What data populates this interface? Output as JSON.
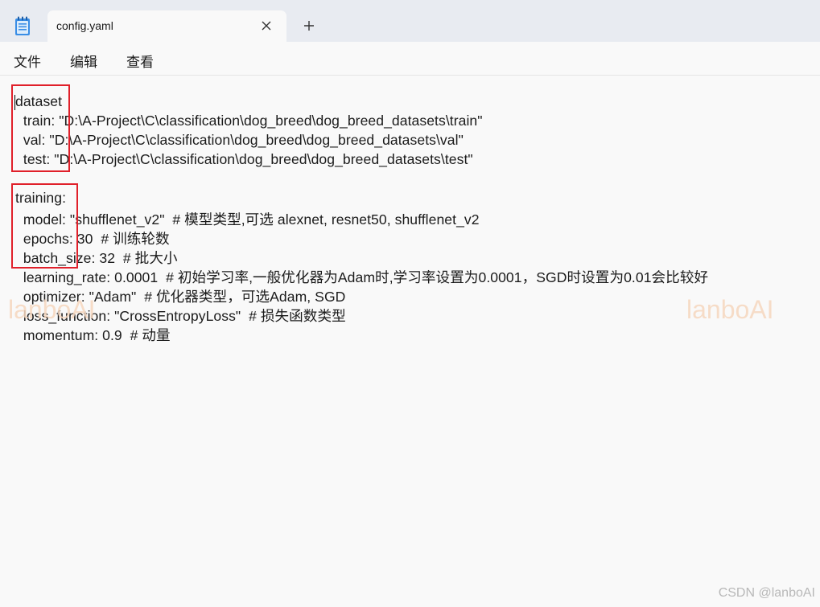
{
  "tab": {
    "title": "config.yaml"
  },
  "menu": {
    "file": "文件",
    "edit": "编辑",
    "view": "查看"
  },
  "code_lines": [
    "dataset",
    "  train: \"D:\\A-Project\\C\\classification\\dog_breed\\dog_breed_datasets\\train\"",
    "  val: \"D:\\A-Project\\C\\classification\\dog_breed\\dog_breed_datasets\\val\"",
    "  test: \"D:\\A-Project\\C\\classification\\dog_breed\\dog_breed_datasets\\test\"",
    "",
    "training:",
    "  model: \"shufflenet_v2\"  # 模型类型,可选 alexnet, resnet50, shufflenet_v2",
    "  epochs: 30  # 训练轮数",
    "  batch_size: 32  # 批大小",
    "  learning_rate: 0.0001  # 初始学习率,一般优化器为Adam时,学习率设置为0.0001，SGD时设置为0.01会比较好",
    "  optimizer: \"Adam\"  # 优化器类型，可选Adam, SGD",
    "  loss_function: \"CrossEntropyLoss\"  # 损失函数类型",
    "  momentum: 0.9  # 动量"
  ],
  "watermark": "lanboAI",
  "credit": "CSDN @lanboAI",
  "colors": {
    "highlight": "#e0202a",
    "tabbar": "#e8ebf1",
    "editor_bg": "#f9f9f9"
  },
  "icons": {
    "app": "notepad-icon",
    "close": "close-icon",
    "new_tab": "plus-icon"
  }
}
